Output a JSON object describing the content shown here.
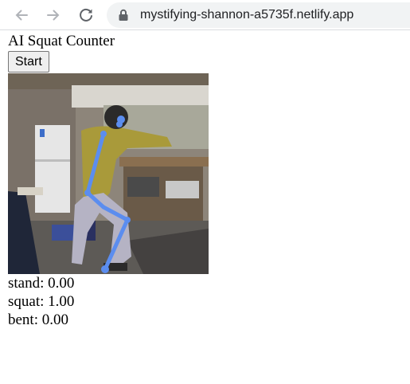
{
  "browser": {
    "url": "mystifying-shannon-a5735f.netlify.app",
    "icons": {
      "back": "back-arrow-icon",
      "forward": "forward-arrow-icon",
      "reload": "reload-icon",
      "secure": "lock-icon"
    }
  },
  "app": {
    "title": "AI Squat Counter",
    "start_label": "Start",
    "stats": [
      {
        "label": "stand:",
        "value": "0.00"
      },
      {
        "label": "squat:",
        "value": "1.00"
      },
      {
        "label": "bent:",
        "value": "0.00"
      }
    ],
    "pose_overlay_color": "#5b8def"
  }
}
